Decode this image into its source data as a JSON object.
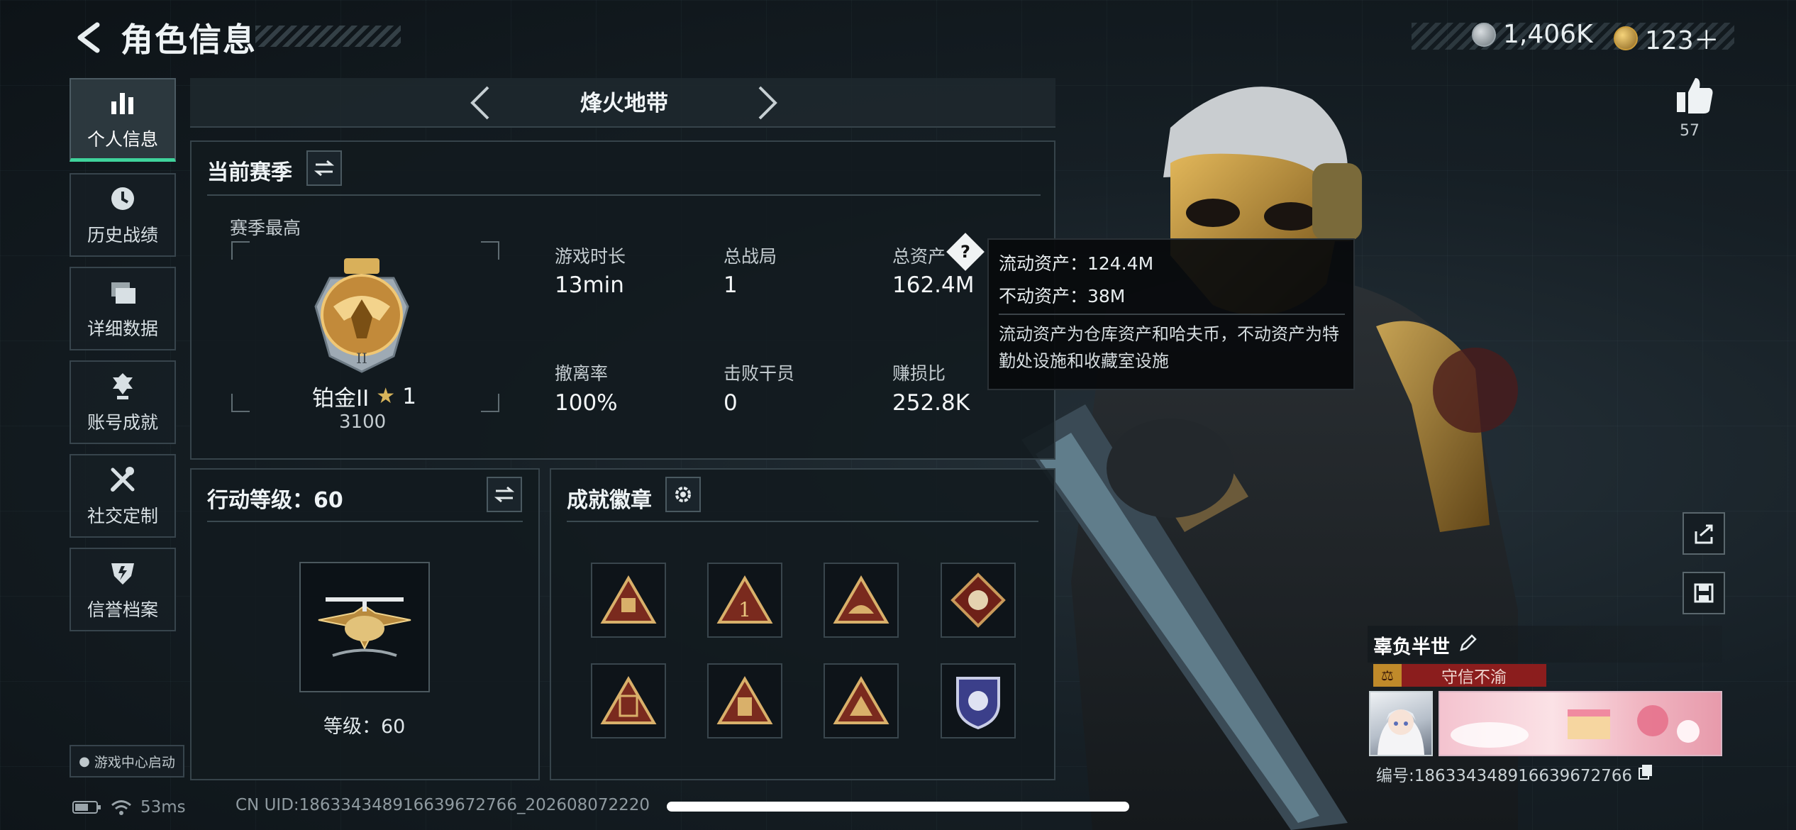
{
  "header": {
    "back_icon": "chevron-left-icon",
    "title": "角色信息",
    "currency": [
      {
        "icon": "silver-coin-icon",
        "value": "1,406K"
      },
      {
        "icon": "gold-coin-icon",
        "value": "123＋"
      }
    ]
  },
  "sidebar": {
    "items": [
      {
        "label": "个人信息",
        "icon": "bar-chart-icon",
        "active": true
      },
      {
        "label": "历史战绩",
        "icon": "clock-icon",
        "active": false
      },
      {
        "label": "详细数据",
        "icon": "folder-icon",
        "active": false
      },
      {
        "label": "账号成就",
        "icon": "medal-icon",
        "active": false
      },
      {
        "label": "社交定制",
        "icon": "tools-icon",
        "active": false
      },
      {
        "label": "信誉档案",
        "icon": "shield-icon",
        "active": false
      }
    ],
    "game_center": "游戏中心启动"
  },
  "mode": {
    "title": "烽火地带"
  },
  "season": {
    "title": "当前赛季",
    "best_label": "赛季最高",
    "rank_name": "铂金II",
    "rank_stars": "1",
    "rank_points": "3100",
    "stats": [
      {
        "label": "游戏时长",
        "value": "13min"
      },
      {
        "label": "总战局",
        "value": "1"
      },
      {
        "label": "总资产",
        "value": "162.4M"
      },
      {
        "label": "撤离率",
        "value": "100%"
      },
      {
        "label": "击败干员",
        "value": "0"
      },
      {
        "label": "赚损比",
        "value": "252.8K"
      }
    ]
  },
  "tooltip": {
    "liquid": "流动资产：124.4M",
    "fixed": "不动资产：38M",
    "desc": "流动资产为仓库资产和哈夫币，不动资产为特勤处设施和收藏室设施"
  },
  "action_level": {
    "title": "行动等级：60",
    "level_text": "等级：60"
  },
  "achievements": {
    "title": "成就徽章",
    "badges": [
      "badge-1",
      "badge-2",
      "badge-3",
      "badge-4",
      "badge-5",
      "badge-6",
      "badge-7",
      "badge-8"
    ]
  },
  "right": {
    "likes": "57",
    "player_name": "辜负半世",
    "reputation_tag": "守信不渝",
    "player_id": "编号:1863343489166396727​66"
  },
  "footer": {
    "ping": "53ms",
    "uid": "CN UID:186334348916639672766_202608072220"
  },
  "colors": {
    "accent_green": "#3fd39b",
    "tag_red": "#8b1d1d",
    "background": "#10171c"
  }
}
